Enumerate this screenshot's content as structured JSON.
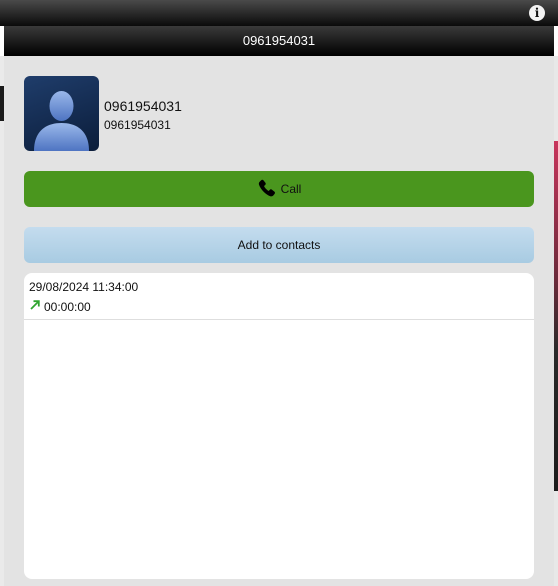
{
  "window": {
    "info_icon": "info-icon",
    "info_glyph": "i"
  },
  "dialog": {
    "title": "0961954031"
  },
  "contact": {
    "avatar_icon": "person-silhouette-icon",
    "name": "0961954031",
    "number": "0961954031"
  },
  "actions": {
    "call_label": "Call",
    "call_icon": "phone-handset-icon",
    "add_contact_label": "Add to contacts"
  },
  "colors": {
    "call_button": "#4a961e",
    "add_contact_button": "#b5d4e9",
    "outgoing_arrow": "#2fa52f"
  },
  "history": [
    {
      "date": "29/08/2024 11:34:00",
      "direction_icon": "outgoing-call-arrow-icon",
      "duration": "00:00:00"
    }
  ]
}
